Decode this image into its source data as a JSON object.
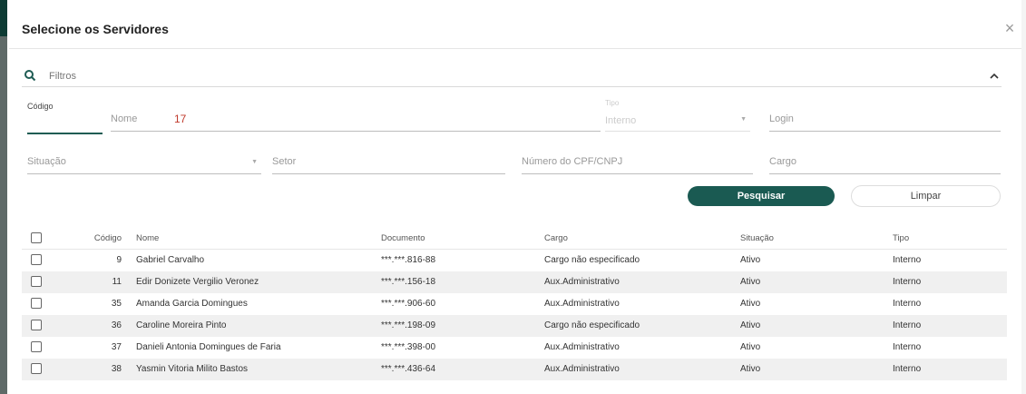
{
  "dialog": {
    "title": "Selecione os Servidores",
    "close": "×"
  },
  "filters": {
    "label": "Filtros",
    "codigo_label": "Código",
    "nome_label": "Nome",
    "nome_value": "17",
    "tipo_label": "Tipo",
    "tipo_value": "Interno",
    "login_label": "Login",
    "situacao_label": "Situação",
    "setor_label": "Setor",
    "cpf_label": "Número do CPF/CNPJ",
    "cargo_label": "Cargo"
  },
  "buttons": {
    "pesquisar": "Pesquisar",
    "limpar": "Limpar"
  },
  "colors": {
    "accent": "#1a5a52"
  },
  "table": {
    "headers": {
      "codigo": "Código",
      "nome": "Nome",
      "documento": "Documento",
      "cargo": "Cargo",
      "situacao": "Situação",
      "tipo": "Tipo"
    },
    "rows": [
      {
        "codigo": "9",
        "nome": "Gabriel Carvalho",
        "documento": "***.***.816-88",
        "cargo": "Cargo não especificado",
        "situacao": "Ativo",
        "tipo": "Interno"
      },
      {
        "codigo": "11",
        "nome": "Edir Donizete Vergilio Veronez",
        "documento": "***.***.156-18",
        "cargo": "Aux.Administrativo",
        "situacao": "Ativo",
        "tipo": "Interno"
      },
      {
        "codigo": "35",
        "nome": "Amanda Garcia Domingues",
        "documento": "***.***.906-60",
        "cargo": "Aux.Administrativo",
        "situacao": "Ativo",
        "tipo": "Interno"
      },
      {
        "codigo": "36",
        "nome": "Caroline Moreira Pinto",
        "documento": "***.***.198-09",
        "cargo": "Cargo não especificado",
        "situacao": "Ativo",
        "tipo": "Interno"
      },
      {
        "codigo": "37",
        "nome": "Danieli Antonia Domingues de Faria",
        "documento": "***.***.398-00",
        "cargo": "Aux.Administrativo",
        "situacao": "Ativo",
        "tipo": "Interno"
      },
      {
        "codigo": "38",
        "nome": "Yasmin Vitoria Milito Bastos",
        "documento": "***.***.436-64",
        "cargo": "Aux.Administrativo",
        "situacao": "Ativo",
        "tipo": "Interno"
      }
    ]
  }
}
